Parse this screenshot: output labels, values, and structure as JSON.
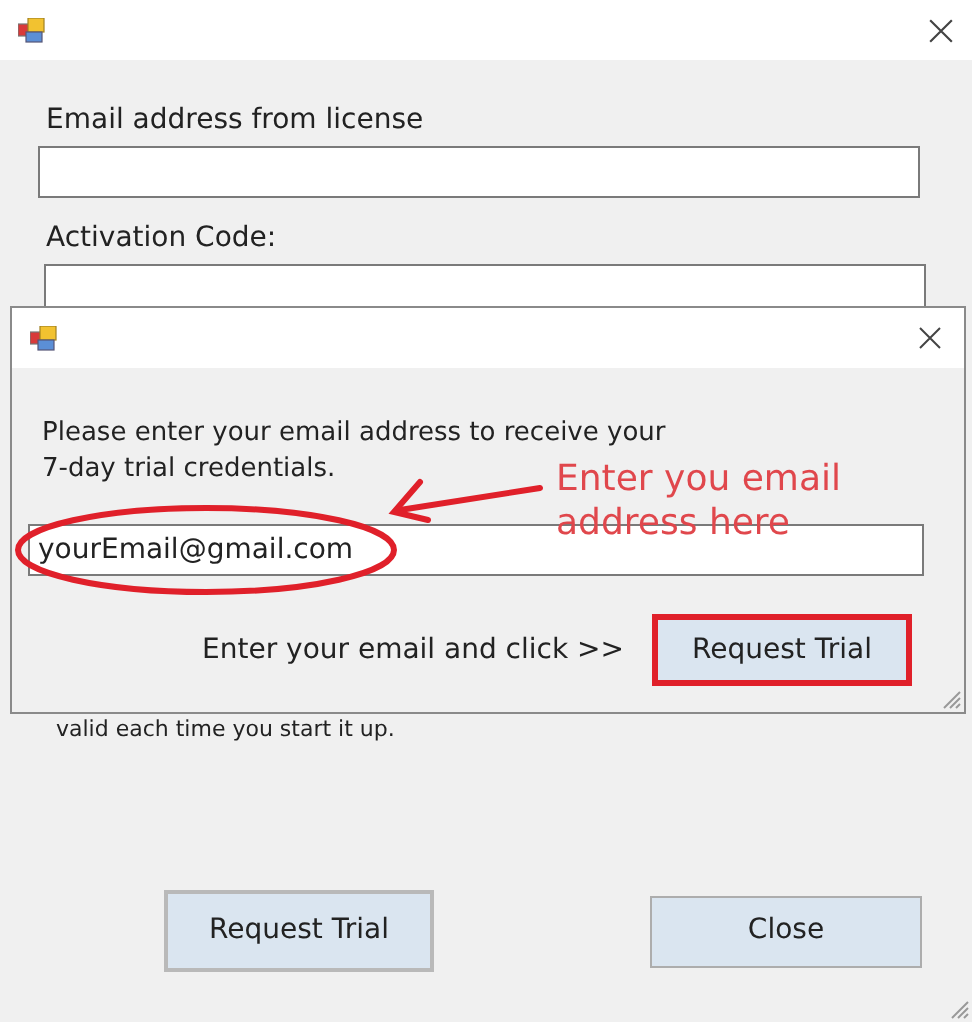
{
  "window": {
    "fields": [
      {
        "label": "Email address from license"
      },
      {
        "label": "Activation Code:"
      }
    ],
    "note": "valid each time you start it up.",
    "buttons": [
      {
        "label": "Request Trial",
        "focused": true
      },
      {
        "label": "Close",
        "focused": false
      }
    ]
  },
  "dialog": {
    "message_lines": [
      "Please enter your email address to receive your",
      "7-day trial credentials."
    ],
    "email_field": {
      "value": "yourEmail@gmail.com"
    },
    "hint": "Enter your email and click >>",
    "button": "Request Trial"
  },
  "annotation": {
    "text": "Enter you email address here"
  }
}
